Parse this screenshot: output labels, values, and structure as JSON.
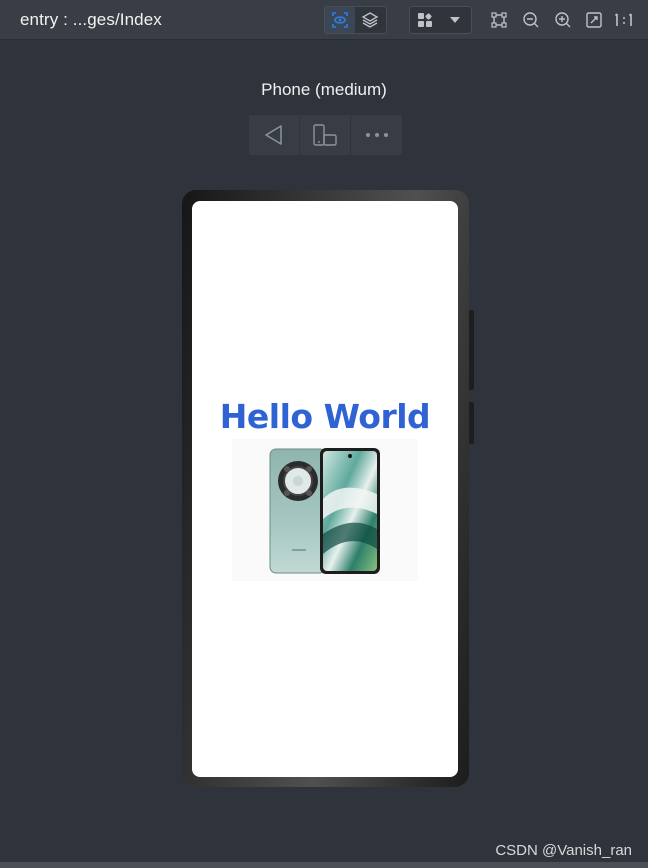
{
  "header": {
    "title": "entry : ...ges/Index",
    "accent": "#2f7de1"
  },
  "preview": {
    "device_label": "Phone (medium)"
  },
  "device_toolbar": {
    "icons": [
      "back-icon",
      "rotate-device-icon",
      "more-icon"
    ]
  },
  "app_screen": {
    "heading": "Hello World",
    "heading_color": "#2f63d4",
    "image": "phone-product-image"
  },
  "watermark": "CSDN @Vanish_ran"
}
